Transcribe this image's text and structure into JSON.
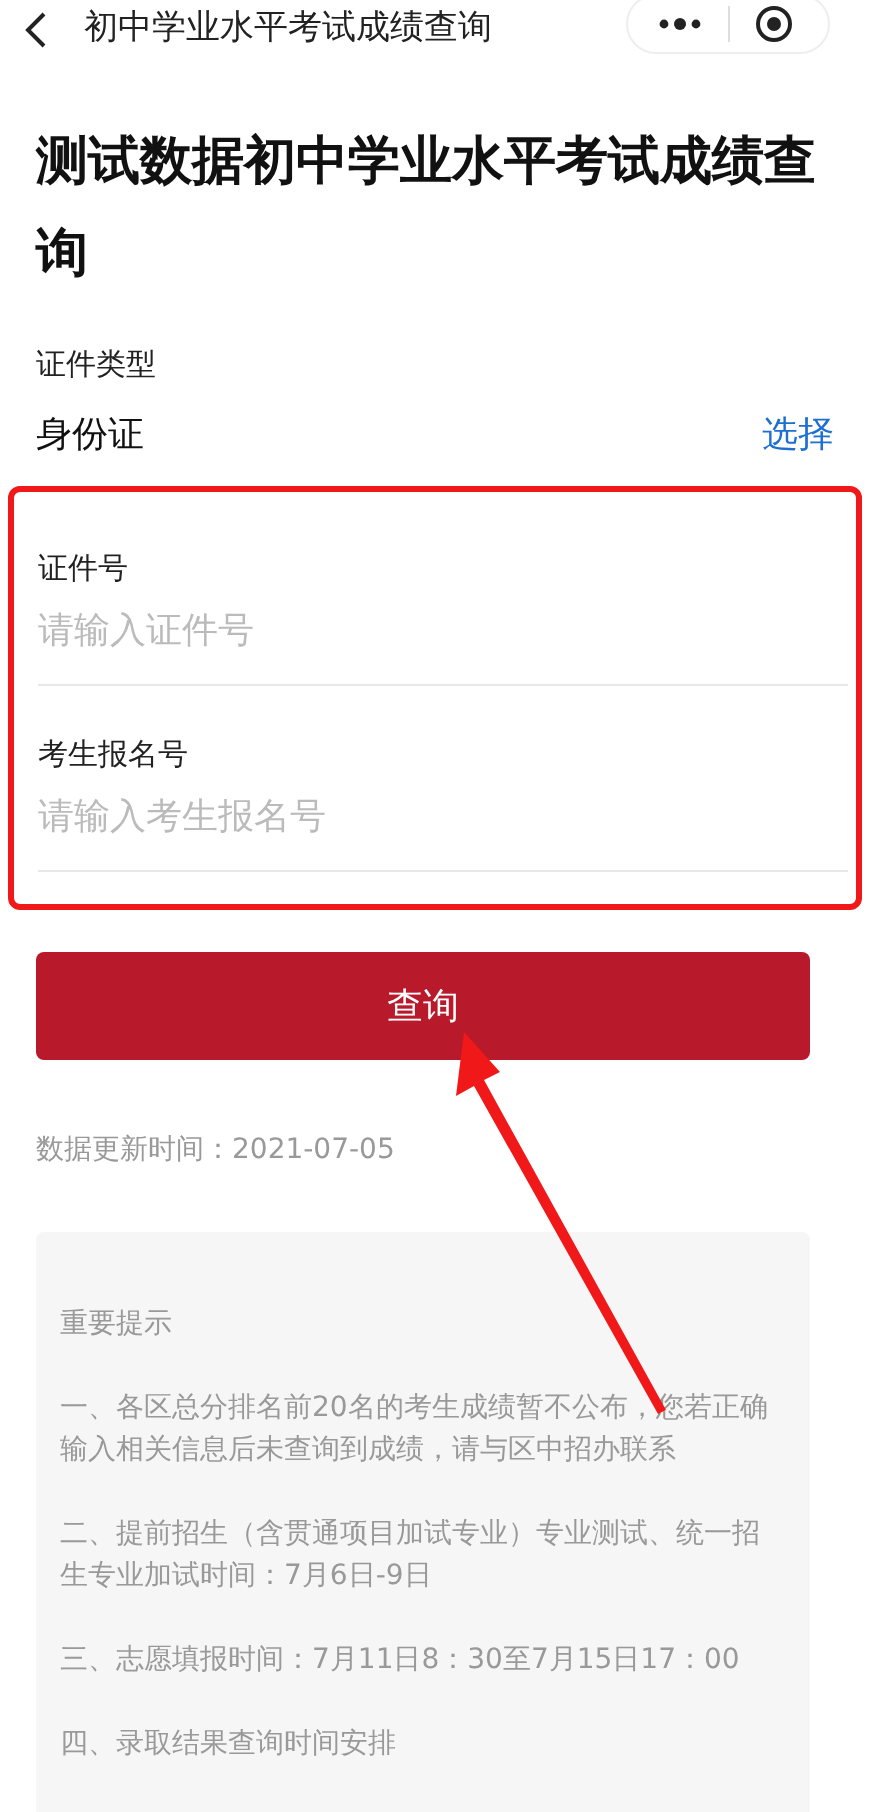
{
  "nav": {
    "title": "初中学业水平考试成绩查询"
  },
  "heading": "测试数据初中学业水平考试成绩查询",
  "id_type": {
    "label": "证件类型",
    "value": "身份证",
    "action": "选择"
  },
  "fields": [
    {
      "label": "证件号",
      "placeholder": "请输入证件号"
    },
    {
      "label": "考生报名号",
      "placeholder": "请输入考生报名号"
    }
  ],
  "submit": "查询",
  "updated": "数据更新时间：2021-07-05",
  "notice": {
    "title": "重要提示",
    "paragraphs": [
      "一、各区总分排名前20名的考生成绩暂不公布，您若正确输入相关信息后未查询到成绩，请与区中招办联系",
      "二、提前招生（含贯通项目加试专业）专业测试、统一招生专业加试时间：7月6日-9日",
      "三、志愿填报时间：7月11日8：30至7月15日17：00",
      "四、录取结果查询时间安排"
    ]
  }
}
